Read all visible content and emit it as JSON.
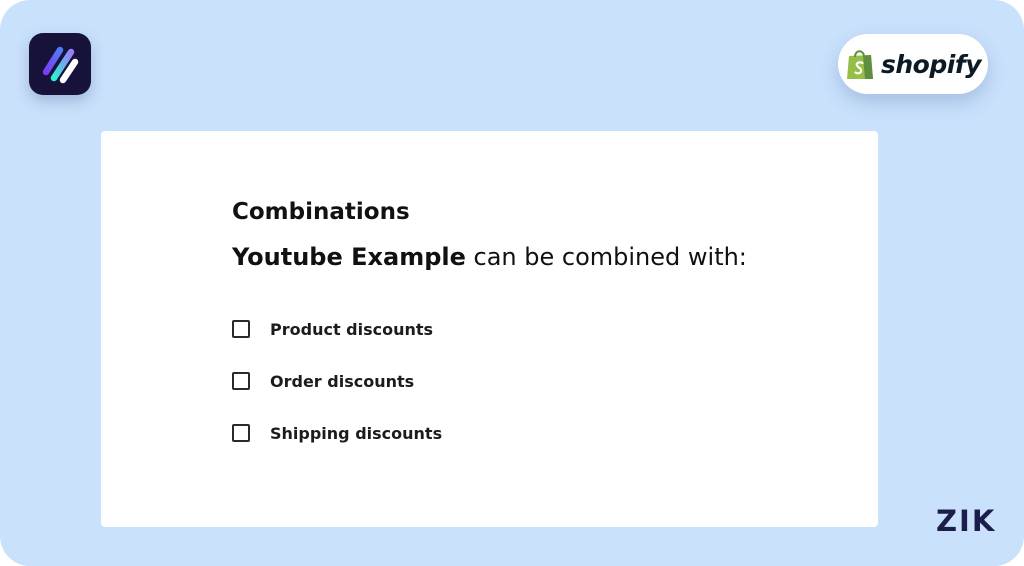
{
  "brand": {
    "app_logo_icon": "double-slash-app-icon",
    "shopify_icon": "shopify-bag-icon",
    "shopify_wordmark": "shopify",
    "corner_mark": "ZIK"
  },
  "card": {
    "title": "Combinations",
    "subtitle_strong": "Youtube Example",
    "subtitle_rest": " can be combined with:",
    "options": [
      {
        "label": "Product discounts",
        "checked": false
      },
      {
        "label": "Order discounts",
        "checked": false
      },
      {
        "label": "Shipping discounts",
        "checked": false
      }
    ]
  },
  "colors": {
    "background": "#c9e1fb",
    "card": "#ffffff",
    "logo_bg": "#17123a",
    "shopify_green": "#95bf47",
    "text": "#111111"
  }
}
